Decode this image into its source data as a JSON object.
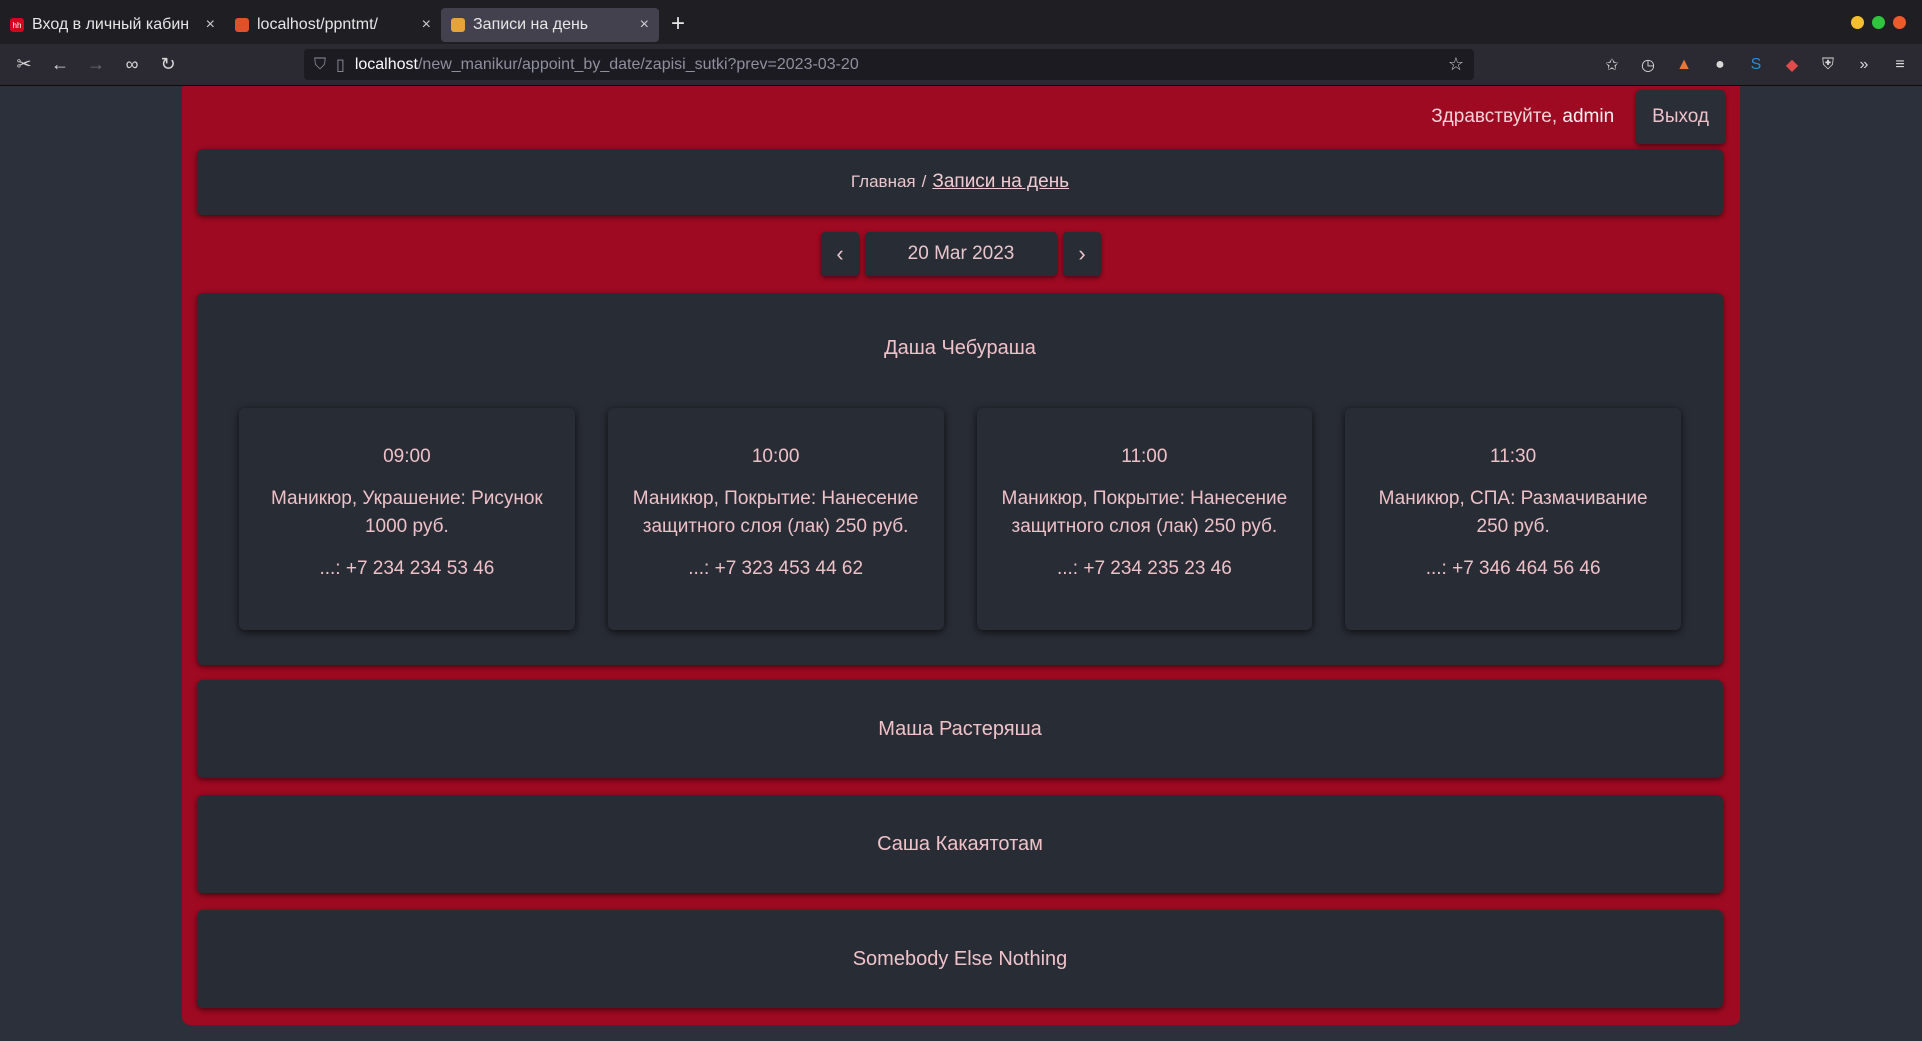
{
  "browser": {
    "tabs": [
      {
        "title": "Вход в личный кабин",
        "favicon_text": "hh",
        "favicon_color": "#d6001c"
      },
      {
        "title": "localhost/ppntmt/",
        "favicon_text": "",
        "favicon_color": "#e0502a"
      },
      {
        "title": "Записи на день",
        "favicon_text": "",
        "favicon_color": "#e7a23a",
        "active": true
      }
    ],
    "url_host": "localhost",
    "url_path": "/new_manikur/appoint_by_date/zapisi_sutki?prev=2023-03-20"
  },
  "header": {
    "greeting": "Здравствуйте,",
    "username": "admin",
    "logout_label": "Выход"
  },
  "breadcrumb": {
    "home": "Главная",
    "separator": "/",
    "current": "Записи на день"
  },
  "datebar": {
    "prev_label": "‹",
    "date": "20 Mar 2023",
    "next_label": "›"
  },
  "masters": [
    {
      "name": "Даша Чебураша",
      "expanded": true,
      "appointments": [
        {
          "time": "09:00",
          "service": "Маникюр, Украшение: Рисунок 1000 руб.",
          "phone": "...: +7 234 234 53 46"
        },
        {
          "time": "10:00",
          "service": "Маникюр, Покрытие: Нанесение защитного слоя (лак) 250 руб.",
          "phone": "...: +7 323 453 44 62"
        },
        {
          "time": "11:00",
          "service": "Маникюр, Покрытие: Нанесение защитного слоя (лак) 250 руб.",
          "phone": "...: +7 234 235 23 46"
        },
        {
          "time": "11:30",
          "service": "Маникюр, СПА: Размачивание 250 руб.",
          "phone": "...: +7 346 464 56 46"
        }
      ]
    },
    {
      "name": "Маша Растеряша",
      "expanded": false
    },
    {
      "name": "Саша Какаятотам",
      "expanded": false
    },
    {
      "name": "Somebody Else Nothing",
      "expanded": false
    }
  ],
  "colors": {
    "accent_red": "#9e0a22",
    "card_bg": "#282c34",
    "text_pink": "#eec0c7"
  }
}
